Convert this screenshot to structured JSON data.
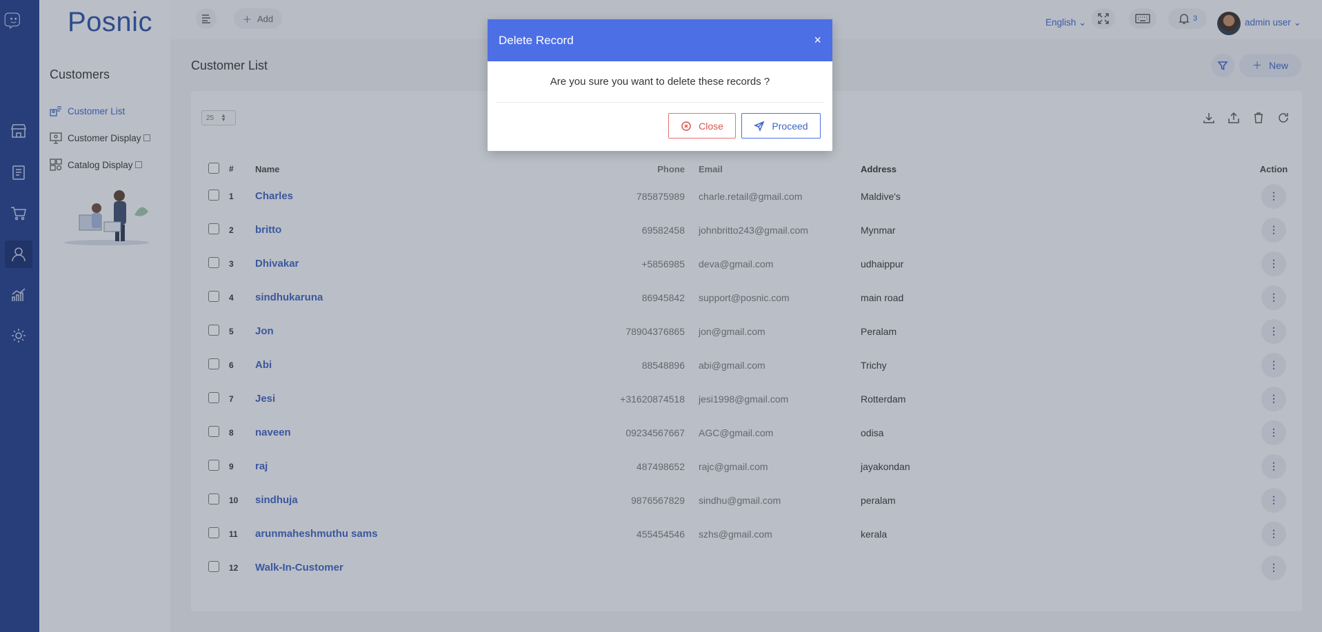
{
  "app": {
    "brand": "Posnic"
  },
  "topbar": {
    "add_label": "Add",
    "language": "English",
    "notification_count": "3",
    "user_name": "admin user"
  },
  "sidebar": {
    "section_title": "Customers",
    "items": [
      {
        "label": "Customer List"
      },
      {
        "label": "Customer Display"
      },
      {
        "label": "Catalog Display"
      }
    ]
  },
  "page": {
    "title": "Customer List",
    "new_label": "New",
    "page_size": "25"
  },
  "table": {
    "headers": {
      "num": "#",
      "name": "Name",
      "phone": "Phone",
      "email": "Email",
      "address": "Address",
      "action": "Action"
    },
    "rows": [
      {
        "num": "1",
        "name": "Charles",
        "phone": "785875989",
        "email": "charle.retail@gmail.com",
        "address": "Maldive's"
      },
      {
        "num": "2",
        "name": "britto",
        "phone": "69582458",
        "email": "johnbritto243@gmail.com",
        "address": "Mynmar"
      },
      {
        "num": "3",
        "name": "Dhivakar",
        "phone": "+5856985",
        "email": "deva@gmail.com",
        "address": "udhaippur"
      },
      {
        "num": "4",
        "name": "sindhukaruna",
        "phone": "86945842",
        "email": "support@posnic.com",
        "address": "main road"
      },
      {
        "num": "5",
        "name": "Jon",
        "phone": "78904376865",
        "email": "jon@gmail.com",
        "address": "Peralam"
      },
      {
        "num": "6",
        "name": "Abi",
        "phone": "88548896",
        "email": "abi@gmail.com",
        "address": "Trichy"
      },
      {
        "num": "7",
        "name": "Jesi",
        "phone": "+31620874518",
        "email": "jesi1998@gmail.com",
        "address": "Rotterdam"
      },
      {
        "num": "8",
        "name": "naveen",
        "phone": "09234567667",
        "email": "AGC@gmail.com",
        "address": "odisa"
      },
      {
        "num": "9",
        "name": "raj",
        "phone": "487498652",
        "email": "rajc@gmail.com",
        "address": "jayakondan"
      },
      {
        "num": "10",
        "name": "sindhuja",
        "phone": "9876567829",
        "email": "sindhu@gmail.com",
        "address": "peralam"
      },
      {
        "num": "11",
        "name": "arunmaheshmuthu sams",
        "phone": "455454546",
        "email": "szhs@gmail.com",
        "address": "kerala"
      },
      {
        "num": "12",
        "name": "Walk-In-Customer",
        "phone": "",
        "email": "",
        "address": ""
      }
    ]
  },
  "modal": {
    "title": "Delete Record",
    "close_symbol": "×",
    "message": "Are you sure you want to delete these records ?",
    "close_label": "Close",
    "proceed_label": "Proceed"
  },
  "colors": {
    "rail": "#1f3a8a",
    "accent": "#3c63c8",
    "modal_header": "#4c6fe6",
    "danger": "#d9534f"
  },
  "icons": [
    "logo-icon",
    "store-icon",
    "clipboard-icon",
    "cart-icon",
    "user-icon",
    "chart-icon",
    "gear-icon",
    "menu-icon",
    "fullscreen-icon",
    "keyboard-icon",
    "bell-icon",
    "filter-icon",
    "download-icon",
    "upload-icon",
    "trash-icon",
    "refresh-icon",
    "kebab-icon",
    "x-circle-icon",
    "send-icon"
  ]
}
